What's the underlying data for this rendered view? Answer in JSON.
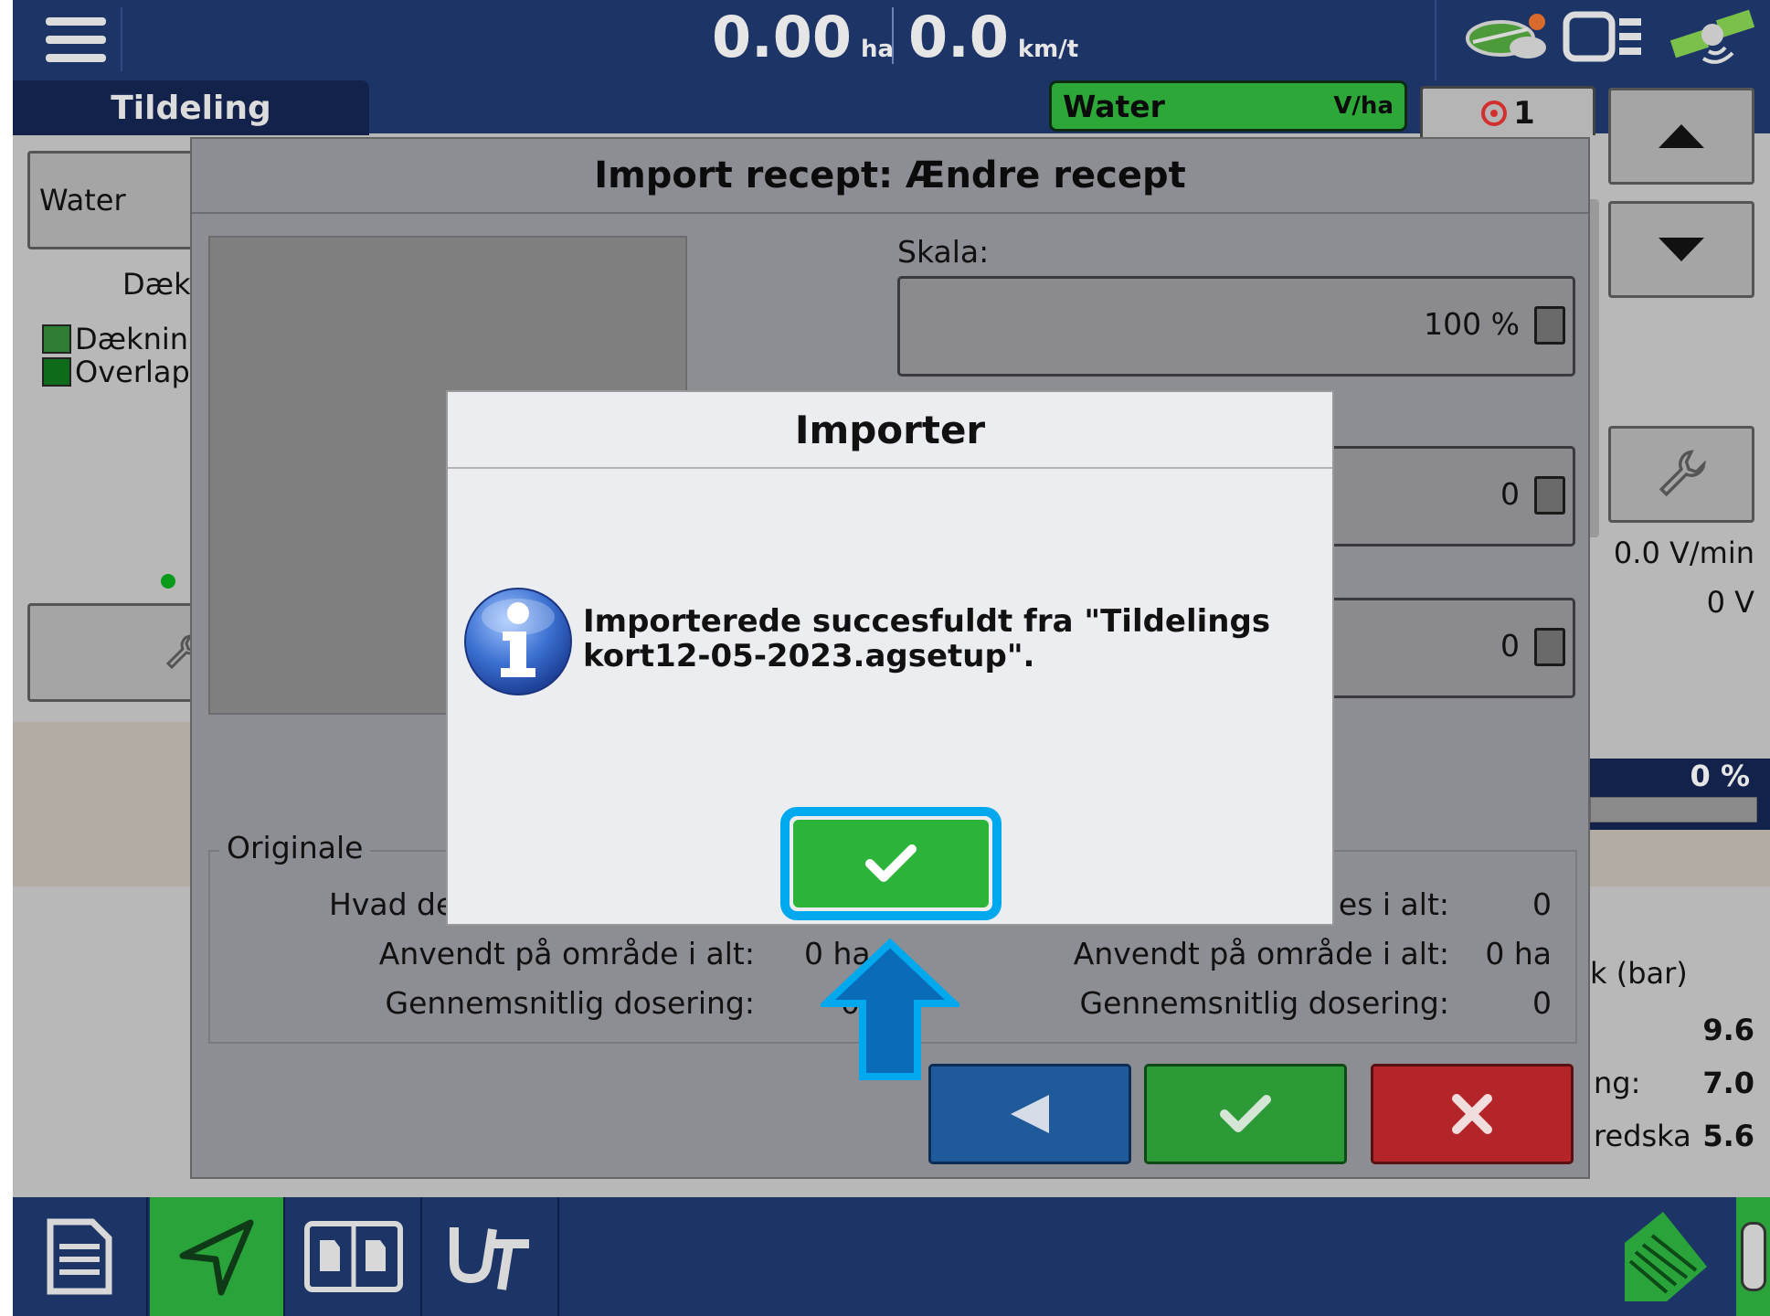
{
  "topbar": {
    "area_value": "0.00",
    "area_unit": "ha",
    "speed_value": "0.0",
    "speed_unit": "km/t",
    "menu_icon": "hamburger-menu-icon",
    "status_icons": [
      "field-cloud-icon",
      "display-icon",
      "gps-satellite-icon"
    ]
  },
  "run_screen": {
    "tab_label": "Tildeling",
    "product_label": "Water",
    "product_tab": {
      "name": "Water",
      "unit": "V/ha"
    },
    "alarm_count": "1",
    "coverage_title": "Dæk",
    "legend": [
      "Dæknin",
      "Overlap"
    ],
    "flow_rate": "0.0 V/min",
    "voltage": "0 V",
    "percent": "0 %",
    "pressure_title": "k (bar)",
    "pressure_values": [
      {
        "label": "",
        "value": "9.6"
      },
      {
        "label": "ng:",
        "value": "7.0"
      },
      {
        "label": "redska",
        "value": "5.6"
      }
    ]
  },
  "dialog": {
    "title": "Import recept: Ændre recept",
    "scale_label": "Skala:",
    "scale_value": "100 %",
    "field2_value": "0",
    "field3_value": "0",
    "original_section": {
      "title": "Originale",
      "rows": [
        {
          "label": "Hvad de",
          "value": ""
        },
        {
          "label": "Anvendt på område i alt:",
          "value": "0 ha"
        },
        {
          "label": "Gennemsnitlig dosering:",
          "value": "0"
        }
      ]
    },
    "new_section": {
      "rows": [
        {
          "label": "es i alt:",
          "value": "0"
        },
        {
          "label": "Anvendt på område i alt:",
          "value": "0 ha"
        },
        {
          "label": "Gennemsnitlig dosering:",
          "value": "0"
        }
      ]
    }
  },
  "modal": {
    "title": "Importer",
    "message_line1": "Importerede succesfuldt fra \"Tildelings",
    "message_line2": "kort12-05-2023.agsetup\".",
    "icon": "info-icon",
    "ok_icon": "checkmark-icon"
  },
  "bottombar": {
    "buttons": [
      "document-icon",
      "navigation-icon",
      "split-screen-icon",
      "ut-icon"
    ]
  },
  "colors": {
    "header_blue": "#1d3566",
    "green": "#2bb33a",
    "highlight": "#00a9ee",
    "back_blue": "#1f5a9a",
    "cancel_red": "#b42529"
  }
}
